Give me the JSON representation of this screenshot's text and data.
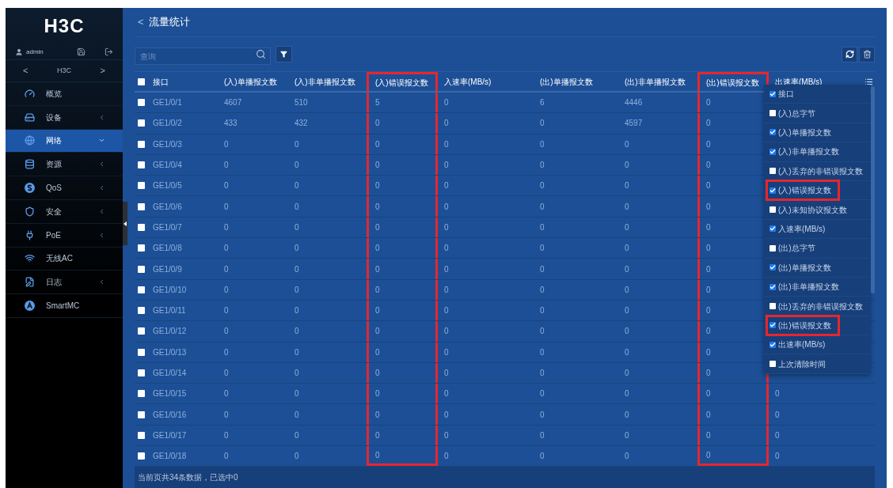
{
  "sidebar": {
    "logo": "H3C",
    "user": "admin",
    "nav": {
      "prev": "<",
      "title": "H3C",
      "next": ">"
    },
    "items": [
      {
        "label": "概览",
        "submenu": false,
        "selected": false
      },
      {
        "label": "设备",
        "submenu": true,
        "selected": false
      },
      {
        "label": "网络",
        "submenu": true,
        "selected": true
      },
      {
        "label": "资源",
        "submenu": true,
        "selected": false
      },
      {
        "label": "QoS",
        "submenu": true,
        "selected": false
      },
      {
        "label": "安全",
        "submenu": true,
        "selected": false
      },
      {
        "label": "PoE",
        "submenu": true,
        "selected": false
      },
      {
        "label": "无线AC",
        "submenu": false,
        "selected": false
      },
      {
        "label": "日志",
        "submenu": true,
        "selected": false
      },
      {
        "label": "SmartMC",
        "submenu": false,
        "selected": false
      }
    ]
  },
  "page": {
    "back": "<",
    "title": "流量统计"
  },
  "search": {
    "placeholder": "查询"
  },
  "table": {
    "select_all": {
      "checked": false
    },
    "columns": [
      {
        "label": "接口",
        "highlighted": false
      },
      {
        "label": "(入)单播报文数",
        "highlighted": false
      },
      {
        "label": "(入)非单播报文数",
        "highlighted": false
      },
      {
        "label": "(入)错误报文数",
        "highlighted": true
      },
      {
        "label": "入速率(MB/s)",
        "highlighted": false
      },
      {
        "label": "(出)单播报文数",
        "highlighted": false
      },
      {
        "label": "(出)非单播报文数",
        "highlighted": false
      },
      {
        "label": "(出)错误报文数",
        "highlighted": true
      },
      {
        "label": "出速率(MB/s)",
        "highlighted": false
      }
    ],
    "rows": [
      {
        "checked": false,
        "cells": [
          "GE1/0/1",
          "4607",
          "510",
          "5",
          "0",
          "6",
          "4446",
          "0"
        ]
      },
      {
        "checked": false,
        "cells": [
          "GE1/0/2",
          "433",
          "432",
          "0",
          "0",
          "0",
          "4597",
          "0"
        ]
      },
      {
        "checked": false,
        "cells": [
          "GE1/0/3",
          "0",
          "0",
          "0",
          "0",
          "0",
          "0",
          "0"
        ]
      },
      {
        "checked": false,
        "cells": [
          "GE1/0/4",
          "0",
          "0",
          "0",
          "0",
          "0",
          "0",
          "0"
        ]
      },
      {
        "checked": false,
        "cells": [
          "GE1/0/5",
          "0",
          "0",
          "0",
          "0",
          "0",
          "0",
          "0"
        ]
      },
      {
        "checked": false,
        "cells": [
          "GE1/0/6",
          "0",
          "0",
          "0",
          "0",
          "0",
          "0",
          "0"
        ]
      },
      {
        "checked": false,
        "cells": [
          "GE1/0/7",
          "0",
          "0",
          "0",
          "0",
          "0",
          "0",
          "0"
        ]
      },
      {
        "checked": false,
        "cells": [
          "GE1/0/8",
          "0",
          "0",
          "0",
          "0",
          "0",
          "0",
          "0"
        ]
      },
      {
        "checked": false,
        "cells": [
          "GE1/0/9",
          "0",
          "0",
          "0",
          "0",
          "0",
          "0",
          "0"
        ]
      },
      {
        "checked": false,
        "cells": [
          "GE1/0/10",
          "0",
          "0",
          "0",
          "0",
          "0",
          "0",
          "0"
        ]
      },
      {
        "checked": false,
        "cells": [
          "GE1/0/11",
          "0",
          "0",
          "0",
          "0",
          "0",
          "0",
          "0"
        ]
      },
      {
        "checked": false,
        "cells": [
          "GE1/0/12",
          "0",
          "0",
          "0",
          "0",
          "0",
          "0",
          "0"
        ]
      },
      {
        "checked": false,
        "cells": [
          "GE1/0/13",
          "0",
          "0",
          "0",
          "0",
          "0",
          "0",
          "0"
        ]
      },
      {
        "checked": false,
        "cells": [
          "GE1/0/14",
          "0",
          "0",
          "0",
          "0",
          "0",
          "0",
          "0"
        ]
      },
      {
        "checked": false,
        "cells": [
          "GE1/0/15",
          "0",
          "0",
          "0",
          "0",
          "0",
          "0",
          "0",
          "0"
        ]
      },
      {
        "checked": false,
        "cells": [
          "GE1/0/16",
          "0",
          "0",
          "0",
          "0",
          "0",
          "0",
          "0",
          "0"
        ]
      },
      {
        "checked": false,
        "cells": [
          "GE1/0/17",
          "0",
          "0",
          "0",
          "0",
          "0",
          "0",
          "0",
          "0"
        ]
      },
      {
        "checked": false,
        "cells": [
          "GE1/0/18",
          "0",
          "0",
          "0",
          "0",
          "0",
          "0",
          "0",
          "0"
        ]
      }
    ],
    "footer": "当前页共34条数据，已选中0"
  },
  "column_menu": [
    {
      "label": "接口",
      "checked": true,
      "highlighted": false
    },
    {
      "label": "(入)总字节",
      "checked": false,
      "highlighted": false
    },
    {
      "label": "(入)单播报文数",
      "checked": true,
      "highlighted": false
    },
    {
      "label": "(入)非单播报文数",
      "checked": true,
      "highlighted": false
    },
    {
      "label": "(入)丢弃的非错误报文数",
      "checked": false,
      "highlighted": false
    },
    {
      "label": "(入)错误报文数",
      "checked": true,
      "highlighted": true
    },
    {
      "label": "(入)未知协议报文数",
      "checked": false,
      "highlighted": false
    },
    {
      "label": "入速率(MB/s)",
      "checked": true,
      "highlighted": false
    },
    {
      "label": "(出)总字节",
      "checked": false,
      "highlighted": false
    },
    {
      "label": "(出)单播报文数",
      "checked": true,
      "highlighted": false
    },
    {
      "label": "(出)非单播报文数",
      "checked": true,
      "highlighted": false
    },
    {
      "label": "(出)丢弃的非错误报文数",
      "checked": false,
      "highlighted": false
    },
    {
      "label": "(出)错误报文数",
      "checked": true,
      "highlighted": true
    },
    {
      "label": "出速率(MB/s)",
      "checked": true,
      "highlighted": false
    },
    {
      "label": "上次清除时间",
      "checked": false,
      "highlighted": false
    }
  ]
}
